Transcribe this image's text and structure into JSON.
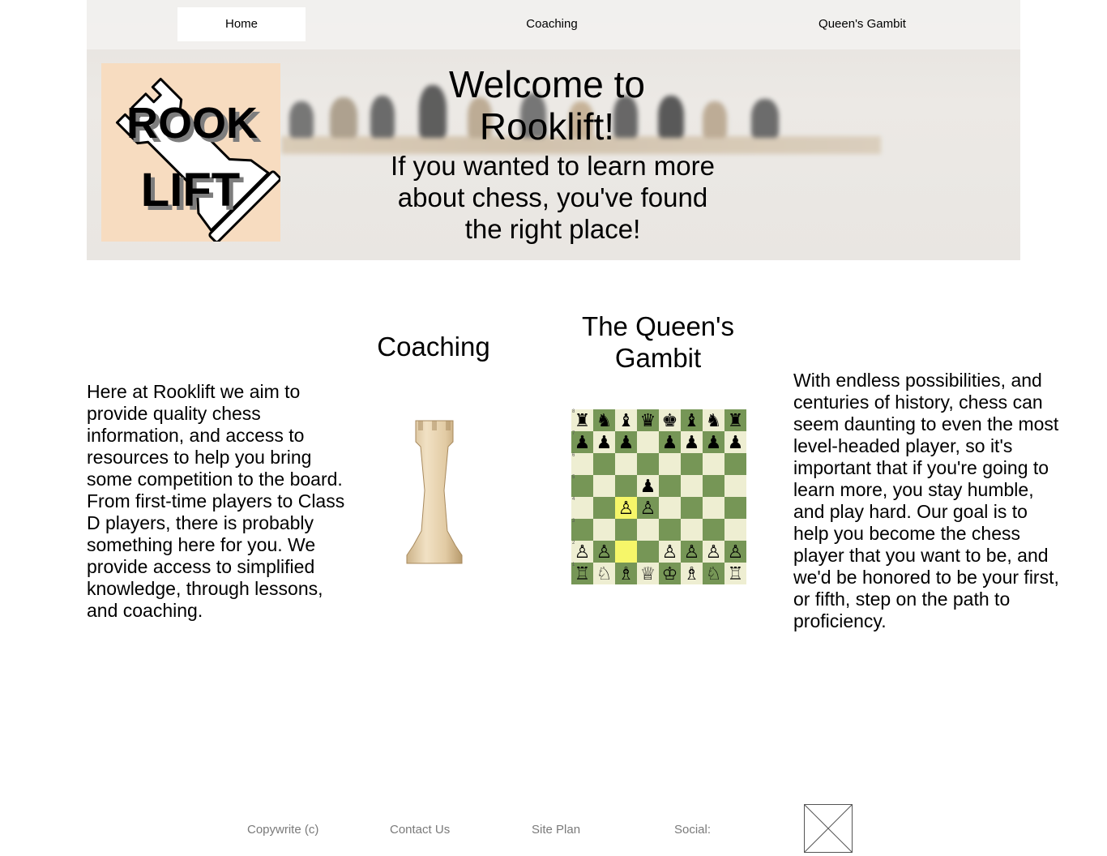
{
  "nav": {
    "items": [
      {
        "label": "Home",
        "active": true
      },
      {
        "label": "Coaching",
        "active": false
      },
      {
        "label": "Queen's Gambit",
        "active": false
      }
    ]
  },
  "logo": {
    "line1": "ROOK",
    "line2": "LIFT",
    "icon": "rook-icon",
    "background": "#f7dcc0"
  },
  "hero": {
    "title": "Welcome to Rooklift!",
    "subtitle": "If you wanted to learn more about chess, you've found the right place!"
  },
  "intro": {
    "text": "Here at Rooklift we aim to provide quality chess information, and access to resources to help you bring some competition to the board. From first-time players to Class D players, there is probably something here for you. We provide access to simplified knowledge, through lessons, and coaching."
  },
  "coaching": {
    "heading": "Coaching",
    "image": "wooden-rook-icon"
  },
  "queens_gambit": {
    "heading": "The Queen's Gambit",
    "board": {
      "light_color": "#eeeed2",
      "dark_color": "#769656",
      "highlight_color": "#f6f669",
      "rank_labels": [
        "8",
        "7",
        "6",
        "5",
        "4",
        "3",
        "2",
        "1"
      ],
      "rows": [
        [
          "♜",
          "♞",
          "♝",
          "♛",
          "♚",
          "♝",
          "♞",
          "♜"
        ],
        [
          "♟",
          "♟",
          "♟",
          "",
          "♟",
          "♟",
          "♟",
          "♟"
        ],
        [
          "",
          "",
          "",
          "",
          "",
          "",
          "",
          ""
        ],
        [
          "",
          "",
          "",
          "♟",
          "",
          "",
          "",
          ""
        ],
        [
          "",
          "",
          "♙",
          "♙",
          "",
          "",
          "",
          ""
        ],
        [
          "",
          "",
          "",
          "",
          "",
          "",
          "",
          ""
        ],
        [
          "♙",
          "♙",
          "",
          "",
          "♙",
          "♙",
          "♙",
          "♙"
        ],
        [
          "♖",
          "♘",
          "♗",
          "♕",
          "♔",
          "♗",
          "♘",
          "♖"
        ]
      ],
      "highlighted": [
        [
          4,
          2
        ],
        [
          6,
          2
        ]
      ]
    }
  },
  "closing": {
    "text": "With endless possibilities, and centuries of history, chess can seem daunting to even the most level-headed player, so it's important that if you're going to learn more, you stay humble, and play hard. Our goal is to help you become the chess player that you want to be, and we'd be honored to be your first, or fifth, step on the path to proficiency."
  },
  "footer": {
    "copyright": "Copywrite (c)",
    "contact": "Contact Us",
    "site_plan": "Site Plan",
    "social_label": "Social:",
    "social_icon": "placeholder-image-icon"
  }
}
